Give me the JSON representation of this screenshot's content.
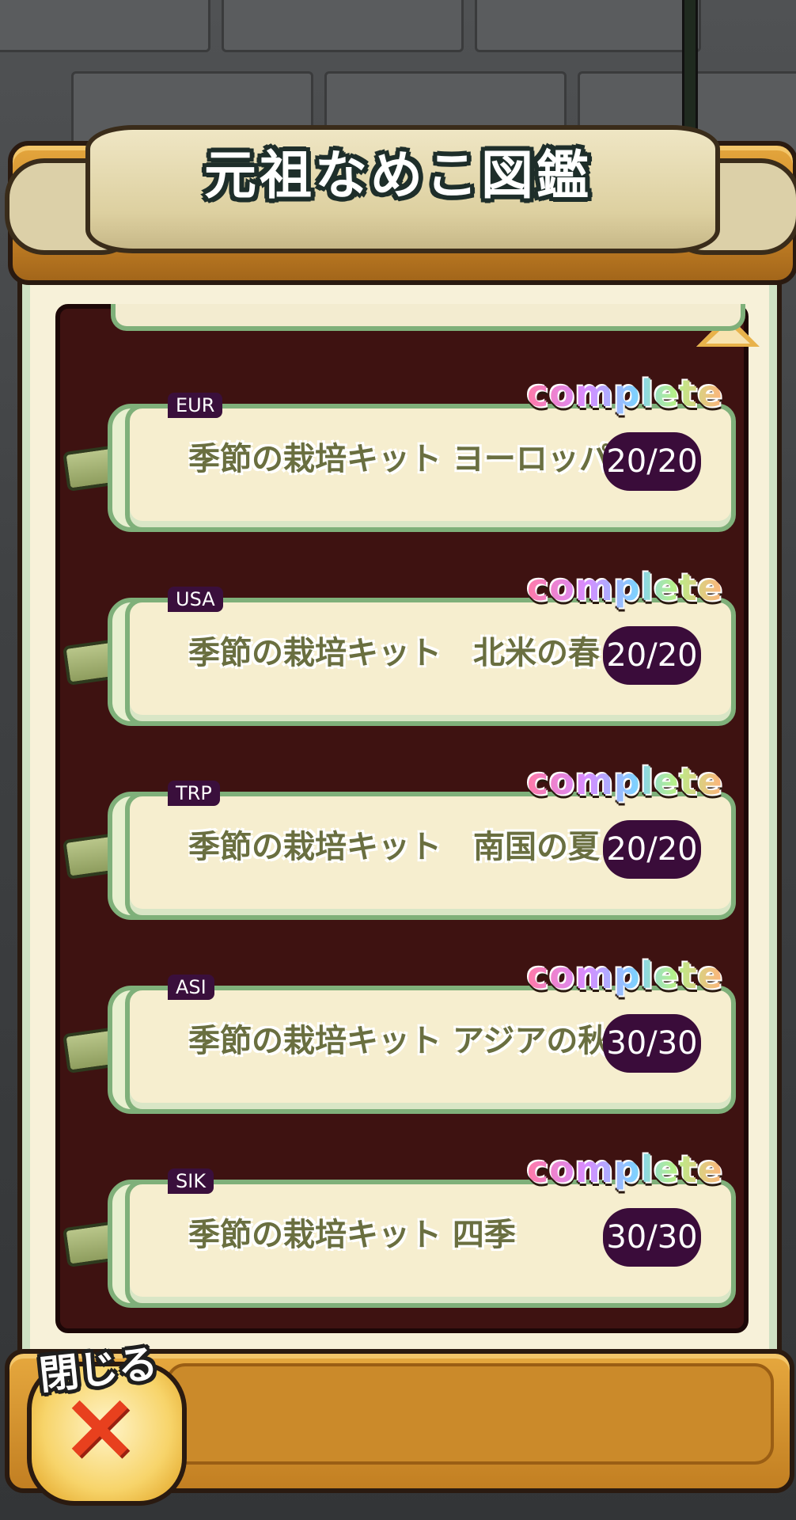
{
  "header": {
    "title": "元祖なめこ図鑑"
  },
  "kits": [
    {
      "code": "EUR",
      "name": "季節の栽培キット ヨーロッパの冬",
      "count": "20/20",
      "badge": "complete"
    },
    {
      "code": "USA",
      "name": "季節の栽培キット　北米の春",
      "count": "20/20",
      "badge": "complete"
    },
    {
      "code": "TRP",
      "name": "季節の栽培キット　南国の夏",
      "count": "20/20",
      "badge": "complete"
    },
    {
      "code": "ASI",
      "name": "季節の栽培キット アジアの秋",
      "count": "30/30",
      "badge": "complete"
    },
    {
      "code": "SIK",
      "name": "季節の栽培キット 四季",
      "count": "30/30",
      "badge": "complete"
    }
  ],
  "footer": {
    "close_label": "閉じる",
    "close_icon": "×"
  },
  "icons": {
    "scroll_up": "triangle-up-icon",
    "close": "close-icon",
    "tie": "scroll-tie-icon"
  },
  "colors": {
    "panel": "#3e1211",
    "badge": "#3a0c3a",
    "wood": "#d28f30",
    "scroll_border": "#7fb07a"
  }
}
